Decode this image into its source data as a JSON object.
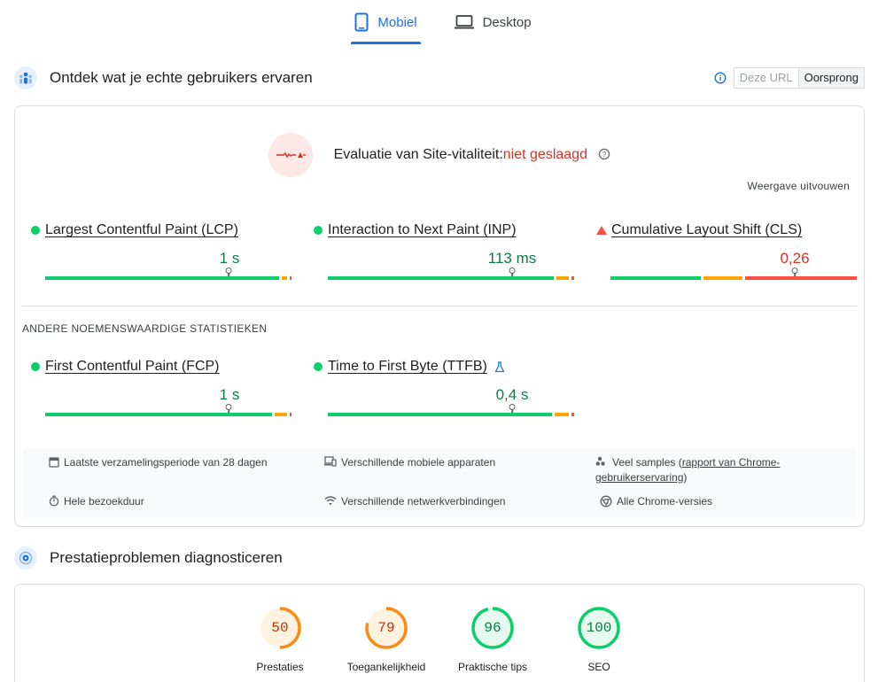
{
  "tabs": [
    {
      "label": "Mobiel",
      "active": true,
      "icon": "phone-icon"
    },
    {
      "label": "Desktop",
      "active": false,
      "icon": "laptop-icon"
    }
  ],
  "field_section": {
    "title": "Ontdek wat je echte gebruikers ervaren",
    "icon": "users-icon",
    "toggle": {
      "this_url": "Deze URL",
      "origin": "Oorsprong",
      "selected": "Oorsprong"
    }
  },
  "evaluation": {
    "label": "Evaluatie van Site-vitaliteit:",
    "status": "niet geslaagd",
    "expand_label": "Weergave uitvouwen"
  },
  "core_metrics": [
    {
      "name": "Largest Contentful Paint (LCP)",
      "value": "1 s",
      "rating": "good",
      "distribution": [
        0.9,
        0.06,
        0.04
      ],
      "marker": 0.75
    },
    {
      "name": "Interaction to Next Paint (INP)",
      "value": "113 ms",
      "rating": "good",
      "distribution": [
        0.93,
        0.05,
        0.02
      ],
      "marker": 0.75
    },
    {
      "name": "Cumulative Layout Shift (CLS)",
      "value": "0,26",
      "rating": "poor",
      "distribution": [
        0.38,
        0.16,
        0.46
      ],
      "marker": 0.75
    }
  ],
  "other_title": "ANDERE NOEMENSWAARDIGE STATISTIEKEN",
  "other_metrics": [
    {
      "name": "First Contentful Paint (FCP)",
      "value": "1 s",
      "rating": "good"
    },
    {
      "name": "Time to First Byte (TTFB)",
      "value": "0,4 s",
      "rating": "good",
      "experimental_icon": "flask-icon"
    }
  ],
  "info": {
    "period": "Laatste verzamelingsperiode van 28 dagen",
    "devices": "Verschillende mobiele apparaten",
    "samples_prefix": "Veel samples (",
    "samples_link": "rapport van Chrome-gebruikerservaring",
    "samples_suffix": ")",
    "duration": "Hele bezoekduur",
    "network": "Verschillende netwerkverbindingen",
    "chrome": "Alle Chrome-versies"
  },
  "diagnose_section": {
    "title": "Prestatieproblemen diagnosticeren",
    "icon": "target-icon"
  },
  "scores": [
    {
      "label": "Prestaties",
      "score": "50",
      "fraction": 0.5,
      "color": "#fa8c16"
    },
    {
      "label": "Toegankelijkheid",
      "score": "79",
      "fraction": 0.79,
      "color": "#fa8c16"
    },
    {
      "label": "Praktische tips",
      "score": "96",
      "fraction": 0.96,
      "color": "#0cce6b"
    },
    {
      "label": "SEO",
      "score": "100",
      "fraction": 1.0,
      "color": "#0cce6b"
    }
  ]
}
